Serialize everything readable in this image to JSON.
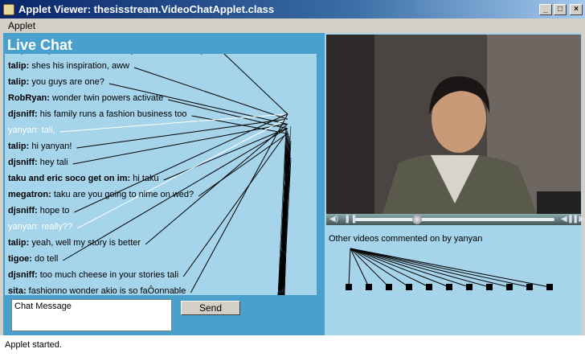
{
  "window": {
    "title": "Applet Viewer: thesisstream.VideoChatApplet.class"
  },
  "menu": {
    "items": [
      "Applet"
    ]
  },
  "chat": {
    "title": "Live Chat",
    "messages": [
      {
        "nick": "talip:",
        "text": "her girlfriend mehtra is a great fashion designer",
        "highlight": false
      },
      {
        "nick": "talip:",
        "text": "shes his inspiration, aww",
        "highlight": false
      },
      {
        "nick": "talip:",
        "text": "you guys are one?",
        "highlight": false
      },
      {
        "nick": "RobRyan:",
        "text": "wonder twin powers activate",
        "highlight": false
      },
      {
        "nick": "djsniff:",
        "text": "his family runs a fashion business too",
        "highlight": false
      },
      {
        "nick": "yanyan:",
        "text": "tali,",
        "highlight": true
      },
      {
        "nick": "talip:",
        "text": "hi yanyan!",
        "highlight": false
      },
      {
        "nick": "djsniff:",
        "text": "hey tali",
        "highlight": false
      },
      {
        "nick": "taku and eric soco get on im:",
        "text": "hi taku",
        "highlight": false
      },
      {
        "nick": "megatron:",
        "text": "taku are you going to nime on wed?",
        "highlight": false
      },
      {
        "nick": "djsniff:",
        "text": "hope to",
        "highlight": false
      },
      {
        "nick": "yanyan:",
        "text": "really??",
        "highlight": true
      },
      {
        "nick": "talip:",
        "text": "yeah, well my story is better",
        "highlight": false
      },
      {
        "nick": "tigoe:",
        "text": "do tell",
        "highlight": false
      },
      {
        "nick": "djsniff:",
        "text": "too much cheese in your stories tali",
        "highlight": false
      },
      {
        "nick": "sita:",
        "text": "fashionno wonder akio is so faÔonnable",
        "highlight": false
      }
    ],
    "input_value": "Chat Message",
    "send_label": "Send"
  },
  "video": {
    "icons": [
      "volume-icon",
      "pause-icon",
      "rewind-icon",
      "fast-forward-icon"
    ],
    "position_fraction": 0.31
  },
  "other_videos": {
    "label": "Other videos commented on by yanyan",
    "count": 11
  },
  "status": {
    "text": "Applet started."
  }
}
